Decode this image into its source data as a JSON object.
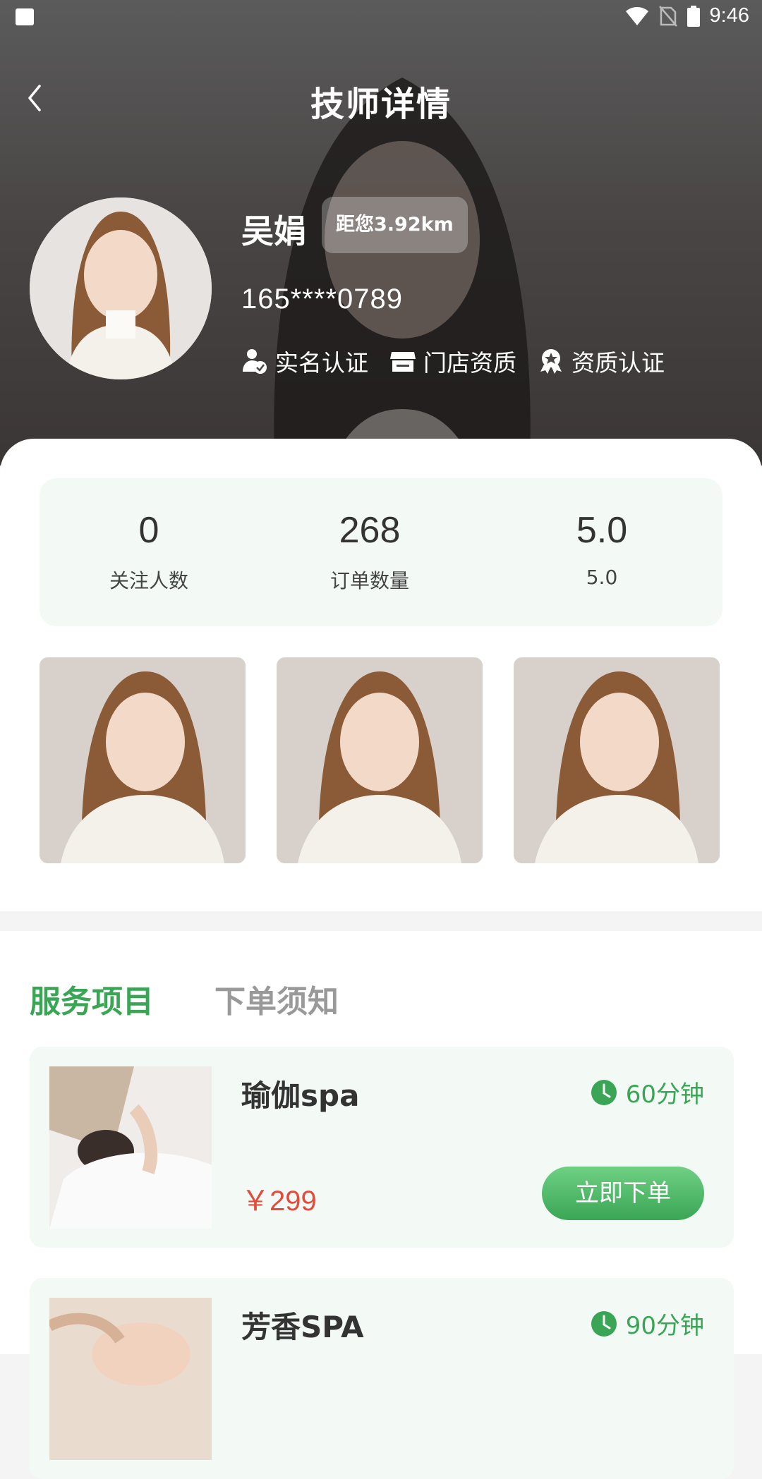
{
  "status_bar": {
    "time": "9:46"
  },
  "header": {
    "title": "技师详情"
  },
  "profile": {
    "name": "吴娟",
    "distance": "距您3.92km",
    "phone": "165****0789",
    "certs": [
      {
        "label": "实名认证",
        "icon": "user-verified-icon"
      },
      {
        "label": "门店资质",
        "icon": "store-icon"
      },
      {
        "label": "资质认证",
        "icon": "badge-icon"
      }
    ]
  },
  "stats": [
    {
      "value": "0",
      "label": "关注人数"
    },
    {
      "value": "268",
      "label": "订单数量"
    },
    {
      "value": "5.0",
      "label": "5.0"
    }
  ],
  "tabs": [
    {
      "label": "服务项目",
      "active": true
    },
    {
      "label": "下单须知",
      "active": false
    }
  ],
  "services": [
    {
      "title": "瑜伽spa",
      "duration": "60分钟",
      "price": "￥299",
      "button": "立即下单"
    },
    {
      "title": "芳香SPA",
      "duration": "90分钟"
    }
  ],
  "colors": {
    "accent": "#3aa655",
    "price": "#e64a3b",
    "stats_bg": "#f3faf6"
  }
}
